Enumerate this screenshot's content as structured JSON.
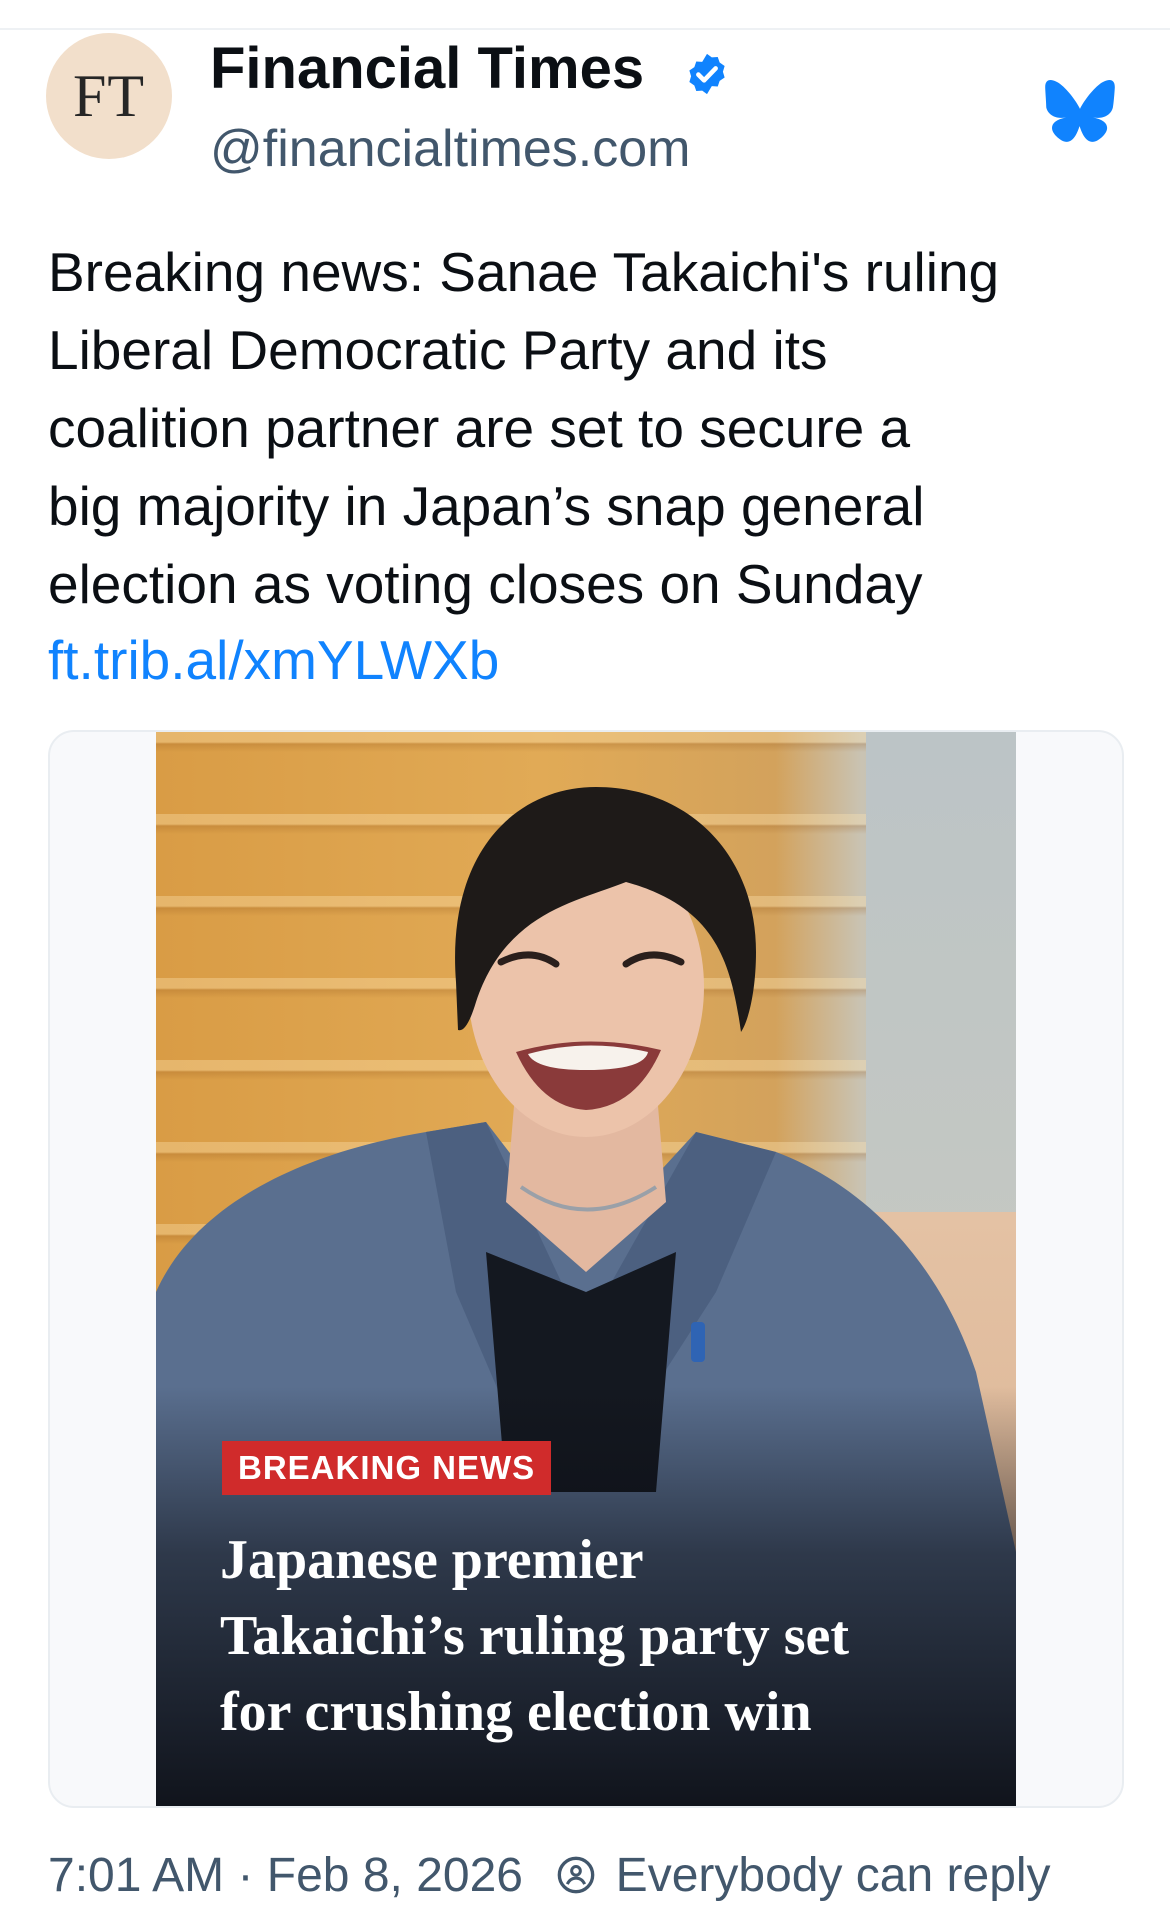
{
  "author": {
    "avatar_text": "FT",
    "display_name": "Financial Times",
    "handle": "@financialtimes.com",
    "verified_icon": "verified-badge-icon",
    "platform_icon": "bluesky-butterfly-icon"
  },
  "post": {
    "text_lines": [
      "Breaking news: Sanae Takaichi's ruling",
      "Liberal Democratic Party and its",
      "coalition partner are set to secure a",
      "big majority in Japan’s snap general",
      "election as voting closes on Sunday"
    ],
    "link": "ft.trib.al/xmYLWXb"
  },
  "embed": {
    "badge": "BREAKING NEWS",
    "headline_lines": [
      "Japanese premier",
      "Takaichi’s ruling party set",
      "for crushing election win"
    ]
  },
  "meta": {
    "time": "7:01 AM",
    "separator": "·",
    "date": "Feb 8, 2026",
    "reply_icon": "reply-settings-icon",
    "reply_setting": "Everybody can reply"
  },
  "colors": {
    "link": "#1083fe",
    "verified": "#1083fe",
    "badge": "#d02b2b",
    "meta_text": "#42576c",
    "avatar_bg": "#f2dfcb"
  }
}
